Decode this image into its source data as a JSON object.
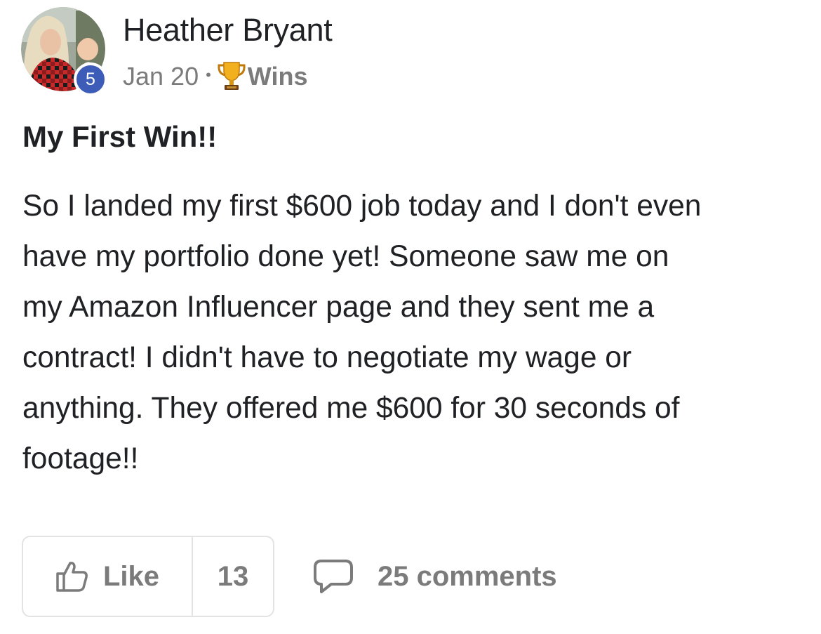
{
  "author": {
    "name": "Heather Bryant",
    "level": "5"
  },
  "meta": {
    "date": "Jan 20",
    "separator": "•",
    "category_icon": "trophy-icon",
    "category": "Wins"
  },
  "post": {
    "title": "My First Win!!",
    "body_lines": [
      "So I landed my first $600 job today and I don't even",
      "have my portfolio done yet! Someone saw me on",
      "my Amazon Influencer page and they sent me a",
      "contract! I didn't have to negotiate my wage or",
      "anything. They offered me $600 for 30 seconds of",
      "footage!!"
    ]
  },
  "actions": {
    "like_label": "Like",
    "like_icon": "thumbs-up-icon",
    "like_count": "13",
    "comment_icon": "comment-bubble-icon",
    "comments_label": "25 comments"
  },
  "colors": {
    "text": "#202124",
    "muted": "#7b7b7b",
    "badge": "#3d5cb8",
    "border": "#e3e3e3"
  }
}
